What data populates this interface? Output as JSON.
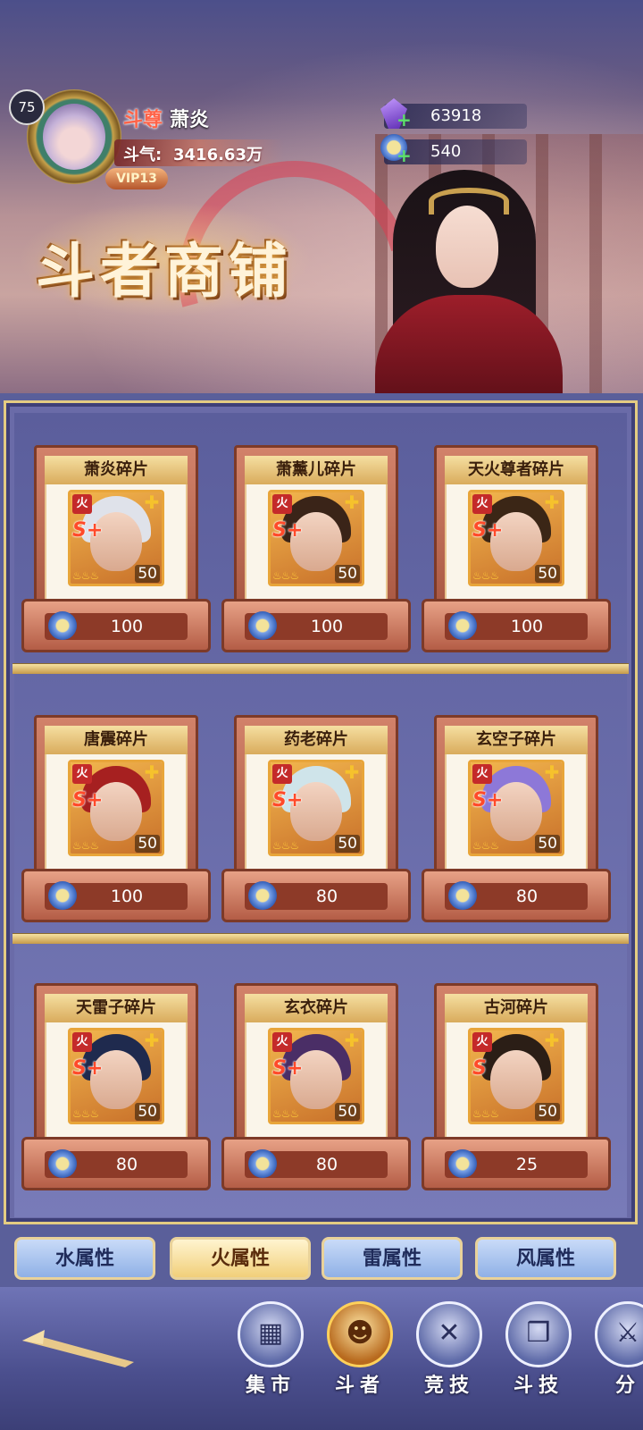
{
  "player": {
    "level": "75",
    "rank": "斗尊",
    "name": "萧炎",
    "power_label": "斗气:",
    "power_value": "3416.63万",
    "vip": "VIP13"
  },
  "currencies": [
    {
      "icon": "purple-gem-icon",
      "value": "63918"
    },
    {
      "icon": "star-coin-icon",
      "value": "540"
    }
  ],
  "shop_title": "斗者商铺",
  "items": [
    {
      "name": "萧炎碎片",
      "element": "火",
      "rarity": "S+",
      "count": "50",
      "price": "100",
      "hair_color": "#dfe2ea"
    },
    {
      "name": "萧薰儿碎片",
      "element": "火",
      "rarity": "S+",
      "count": "50",
      "price": "100",
      "hair_color": "#3a2418"
    },
    {
      "name": "天火尊者碎片",
      "element": "火",
      "rarity": "S+",
      "count": "50",
      "price": "100",
      "hair_color": "#3b2616"
    },
    {
      "name": "唐震碎片",
      "element": "火",
      "rarity": "S+",
      "count": "50",
      "price": "100",
      "hair_color": "#a62020"
    },
    {
      "name": "药老碎片",
      "element": "火",
      "rarity": "S+",
      "count": "50",
      "price": "80",
      "hair_color": "#cfe4ea"
    },
    {
      "name": "玄空子碎片",
      "element": "火",
      "rarity": "S+",
      "count": "50",
      "price": "80",
      "hair_color": "#8d78d8"
    },
    {
      "name": "天雷子碎片",
      "element": "火",
      "rarity": "S+",
      "count": "50",
      "price": "80",
      "hair_color": "#1f2a4e"
    },
    {
      "name": "玄衣碎片",
      "element": "火",
      "rarity": "S+",
      "count": "50",
      "price": "80",
      "hair_color": "#4a2e66"
    },
    {
      "name": "古河碎片",
      "element": "火",
      "rarity": "S",
      "count": "50",
      "price": "25",
      "hair_color": "#2b1e16"
    }
  ],
  "tabs": [
    {
      "label": "水属性",
      "active": false
    },
    {
      "label": "火属性",
      "active": true
    },
    {
      "label": "雷属性",
      "active": false
    },
    {
      "label": "风属性",
      "active": false
    }
  ],
  "nav": [
    {
      "label": "集市",
      "icon": "market-icon",
      "glyph": "▦"
    },
    {
      "label": "斗者",
      "icon": "fighter-icon",
      "glyph": "☻"
    },
    {
      "label": "竞技",
      "icon": "arena-icon",
      "glyph": "✕"
    },
    {
      "label": "斗技",
      "icon": "skill-book-icon",
      "glyph": "❒"
    },
    {
      "label": "分",
      "icon": "partial-nav-icon",
      "glyph": "⚔"
    }
  ],
  "colors": {
    "accent_gold": "#e4cc82",
    "price_bar": "#8d3a28",
    "element_badge": "#c42a2a"
  }
}
